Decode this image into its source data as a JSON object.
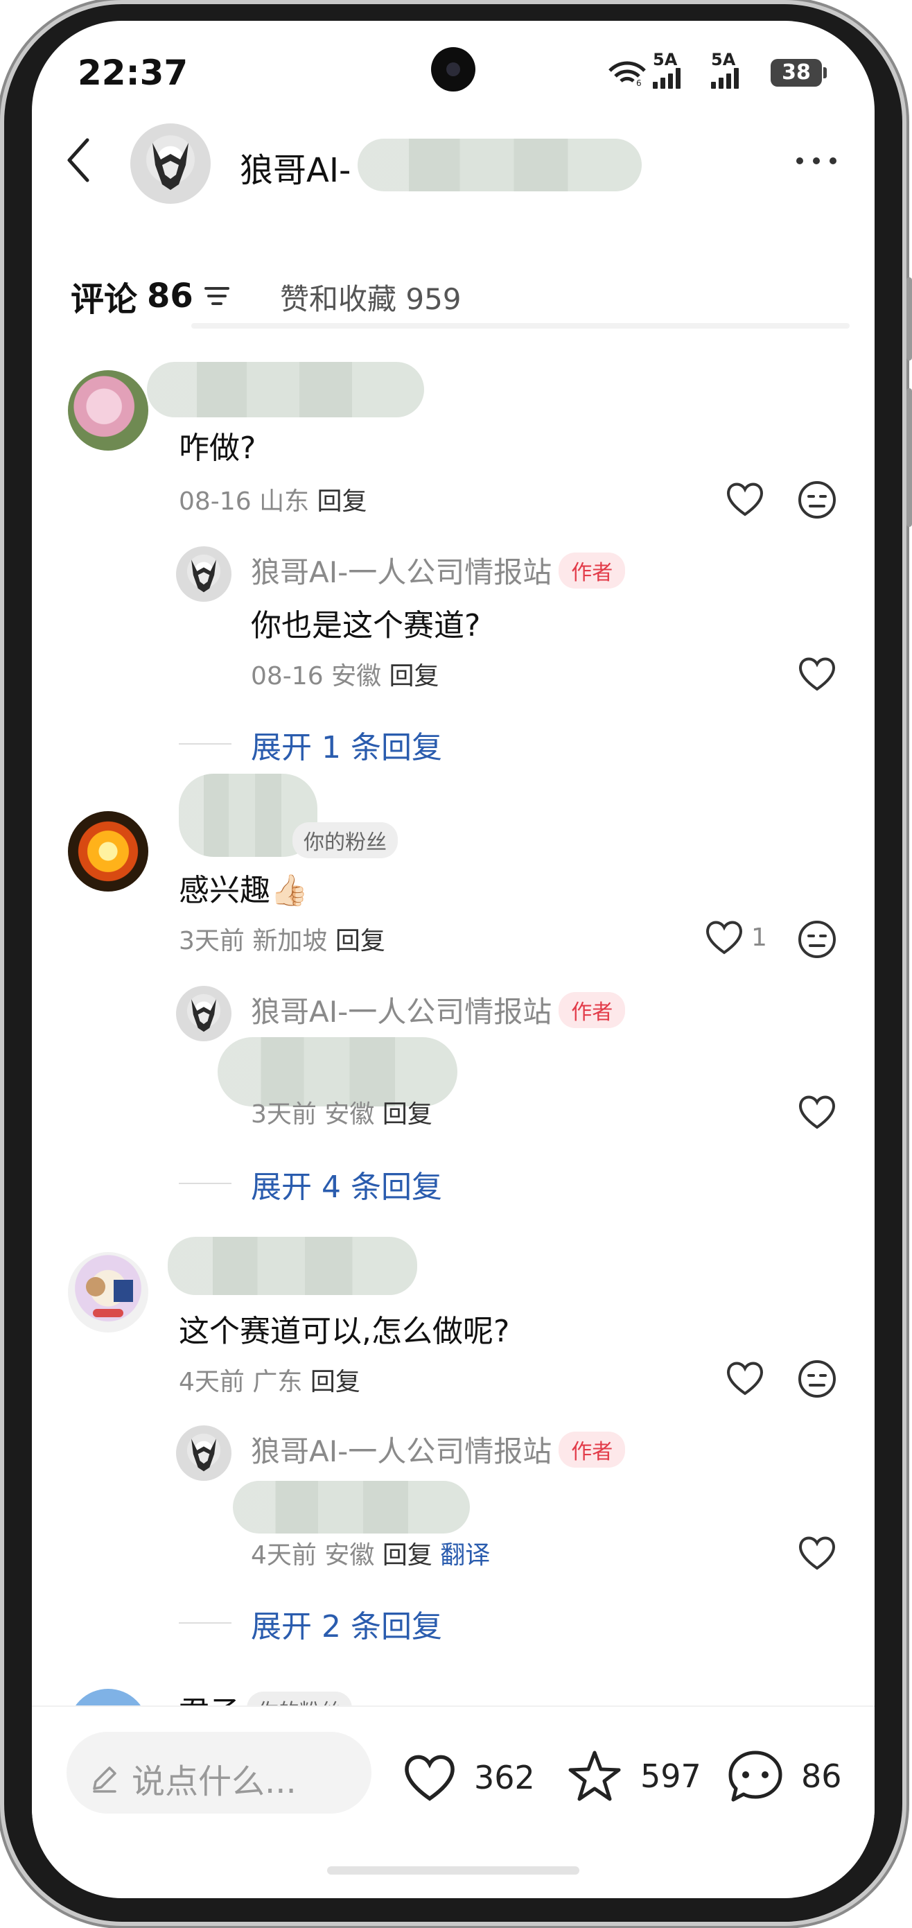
{
  "status_bar": {
    "time": "22:37",
    "battery": "38",
    "network1": "5A",
    "network2": "5A"
  },
  "header": {
    "title": "狼哥AI-"
  },
  "tabs": {
    "comments_label": "评论",
    "comments_count": "86",
    "likes_label": "赞和收藏 959"
  },
  "comments": [
    {
      "text": "咋做?",
      "time": "08-16",
      "location": "山东",
      "reply_label": "回复",
      "reply": {
        "author": "狼哥AI-一人公司情报站",
        "badge": "作者",
        "text": "你也是这个赛道?",
        "time": "08-16",
        "location": "安徽",
        "reply_label": "回复"
      },
      "expand": "展开 1 条回复"
    },
    {
      "fan_badge": "你的粉丝",
      "text": "感兴趣👍🏻",
      "time": "3天前",
      "location": "新加坡",
      "reply_label": "回复",
      "likes": "1",
      "reply": {
        "author": "狼哥AI-一人公司情报站",
        "badge": "作者",
        "time": "3天前",
        "location": "安徽",
        "reply_label": "回复"
      },
      "expand": "展开 4 条回复"
    },
    {
      "text": "这个赛道可以,怎么做呢?",
      "time": "4天前",
      "location": "广东",
      "reply_label": "回复",
      "reply": {
        "author": "狼哥AI-一人公司情报站",
        "badge": "作者",
        "time": "4天前",
        "location": "安徽",
        "reply_label": "回复",
        "translate": "翻译"
      },
      "expand": "展开 2 条回复"
    }
  ],
  "partial_next": {
    "name": "君子",
    "badge": "你的粉丝"
  },
  "bottom_bar": {
    "input_placeholder": "说点什么...",
    "likes": "362",
    "favorites": "597",
    "comments": "86"
  },
  "colors": {
    "author_badge": "#e23b49",
    "link_blue": "#2a5cae",
    "meta_gray": "#8a8a8a"
  }
}
